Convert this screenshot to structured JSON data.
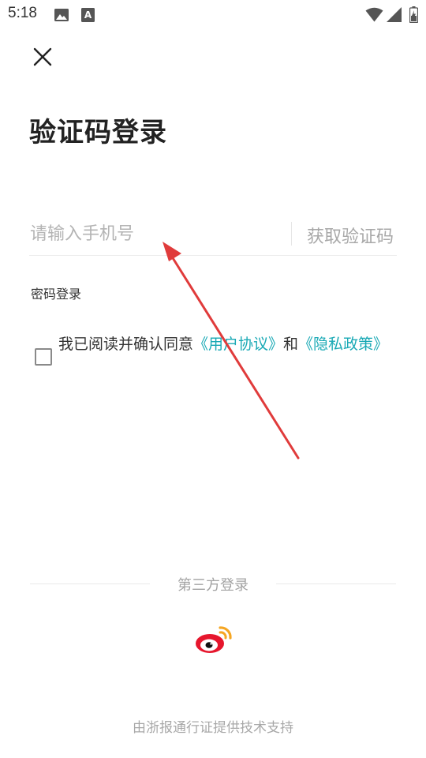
{
  "status_bar": {
    "time": "5:18",
    "left_icons": [
      "image-icon",
      "keyboard-a-icon"
    ],
    "right_icons": [
      "wifi-icon",
      "signal-icon",
      "battery-icon"
    ]
  },
  "header": {
    "close_icon": "close-icon",
    "title": "验证码登录"
  },
  "form": {
    "phone_placeholder": "请输入手机号",
    "phone_value": "",
    "get_code_label": "获取验证码",
    "password_login_label": "密码登录"
  },
  "agreement": {
    "checked": false,
    "prefix": "我已阅读并确认同意",
    "user_agreement": "《用户协议》",
    "connector": "和",
    "privacy_policy": "《隐私政策》"
  },
  "third_party": {
    "label": "第三方登录",
    "providers": [
      "weibo-icon"
    ]
  },
  "footer": {
    "text": "由浙报通行证提供技术支持"
  },
  "colors": {
    "link": "#19a9b5",
    "annotation_arrow": "#e03b3b",
    "placeholder": "#b4b4b4"
  }
}
